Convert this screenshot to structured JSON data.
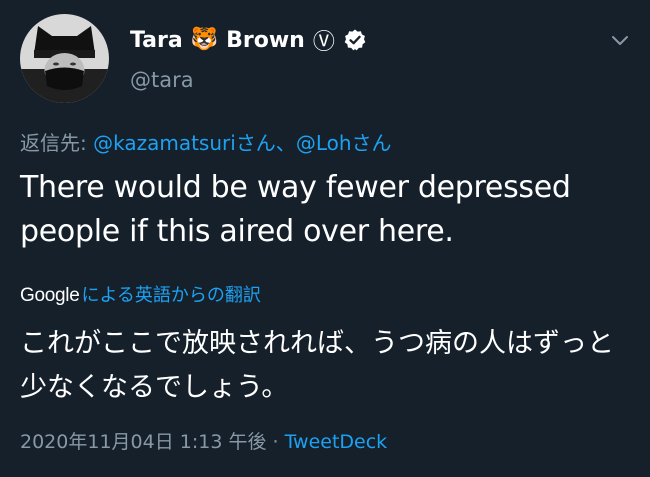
{
  "author": {
    "name_first": "Tara",
    "name_emoji": "🐯",
    "name_last": "Brown",
    "name_mark": "Ⓥ",
    "handle": "@tara",
    "avatar_icon": "avatar-photo",
    "verified_icon": "verified-badge-icon"
  },
  "menu": {
    "icon": "chevron-down-icon"
  },
  "reply": {
    "prefix": "返信先: ",
    "mention1": "@kazamatsuri",
    "suffix1": "さん、",
    "mention2": "@Loh",
    "suffix2": "さん"
  },
  "tweet": {
    "text": "There would be way fewer depressed people if this aired over here."
  },
  "translation": {
    "provider": "Google",
    "link_label": "による英語からの翻訳",
    "text": "これがここで放映されれば、うつ病の人はずっと少なくなるでしょう。"
  },
  "meta": {
    "timestamp": "2020年11月04日 1:13 午後 · ",
    "source": "TweetDeck"
  },
  "colors": {
    "background": "#15202b",
    "text_primary": "#ffffff",
    "text_secondary": "#8899a6",
    "accent": "#1da1f2"
  }
}
